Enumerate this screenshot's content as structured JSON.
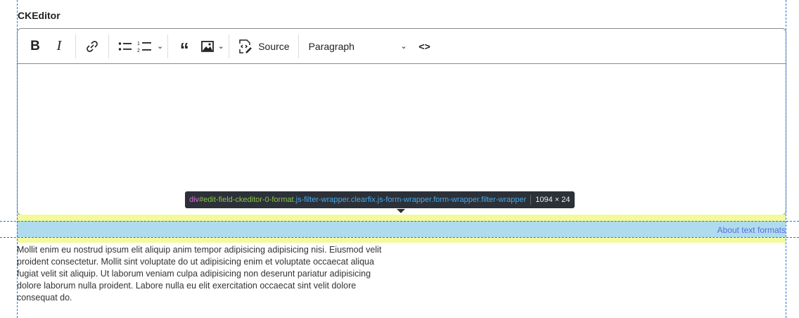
{
  "field_label": "CKEditor",
  "toolbar": {
    "bold": "B",
    "italic": "I",
    "source_label": "Source",
    "heading_value": "Paragraph",
    "code": "<>"
  },
  "tooltip": {
    "tag": "div",
    "id": "#edit-field-ckeditor-0-format",
    "classes": ".js-filter-wrapper.clearfix.js-form-wrapper.form-wrapper.filter-wrapper",
    "dimensions": "1094 × 24"
  },
  "about_link": "About text formats",
  "description": "Mollit enim eu nostrud ipsum elit aliquip anim tempor adipisicing adipisicing nisi. Eiusmod velit proident consectetur. Mollit sint voluptate do ut adipisicing enim et voluptate occaecat aliqua fugiat velit sit aliquip. Ut laborum veniam culpa adipisicing non deserunt pariatur adipisicing dolore laborum nulla proident. Labore nulla eu elit exercitation occaecat sint velit dolore consequat do."
}
